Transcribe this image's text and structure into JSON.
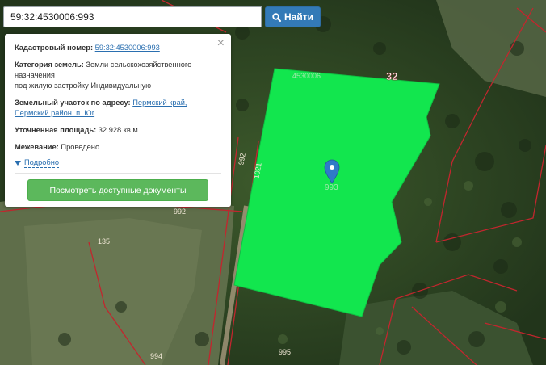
{
  "search": {
    "value": "59:32:4530006:993",
    "button_label": "Найти"
  },
  "card": {
    "cadastral_label": "Кадастровый номер:",
    "cadastral_value": "59:32:4530006:993",
    "category_label": "Категория земель:",
    "category_value_1": "Земли сельскохозяйственного",
    "category_value_2": "назначения",
    "category_value_3": "под жилую застройку Индивидуальную",
    "address_label": "Земельный участок по адресу:",
    "address_value_1": "Пермский край,",
    "address_value_2": "Пермский район, п. Юг",
    "area_label": "Уточненная площадь:",
    "area_value": "32 928 кв.м.",
    "survey_label": "Межевание:",
    "survey_value": "Проведено",
    "more_label": "Подробно",
    "docs_button": "Посмотреть доступные документы",
    "close_icon": "×"
  },
  "map_labels": {
    "parcel_top": "4530006",
    "quarter_32": "32",
    "parcel_center": "993",
    "parcel_992_road": "992",
    "road_1021": "1021",
    "parcel_992": "992",
    "parcel_135": "135",
    "parcel_994": "994",
    "parcel_995": "995"
  },
  "colors": {
    "parcel_fill": "#12e64e",
    "boundary": "#c2262e",
    "search_button": "#337ab7",
    "docs_button": "#5cb85c",
    "marker": "#2f7ac8"
  }
}
